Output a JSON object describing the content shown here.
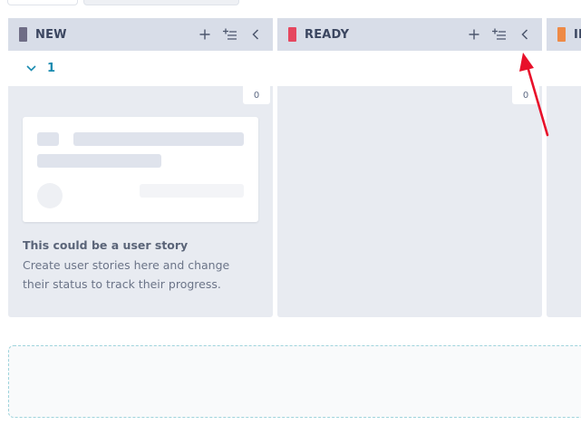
{
  "columns": [
    {
      "title": "NEW",
      "color": "#6f6d86",
      "count": "0"
    },
    {
      "title": "READY",
      "color": "#e5475f",
      "count": "0"
    },
    {
      "title": "IN",
      "color": "#ee8a46",
      "count": ""
    }
  ],
  "swimlane": {
    "count": "1"
  },
  "empty_state": {
    "title": "This could be a user story",
    "description": "Create user stories here and change their status to track their progress."
  },
  "icons": {
    "add": "plus-icon",
    "bulk_add": "bulk-add-icon",
    "collapse": "chevron-left-icon",
    "lane_toggle": "chevron-down-icon"
  },
  "colors": {
    "header_bg": "#d8dde8",
    "column_bg": "#e8ebf1",
    "accent": "#1a8bb0",
    "annotation_arrow": "#e8102a"
  }
}
